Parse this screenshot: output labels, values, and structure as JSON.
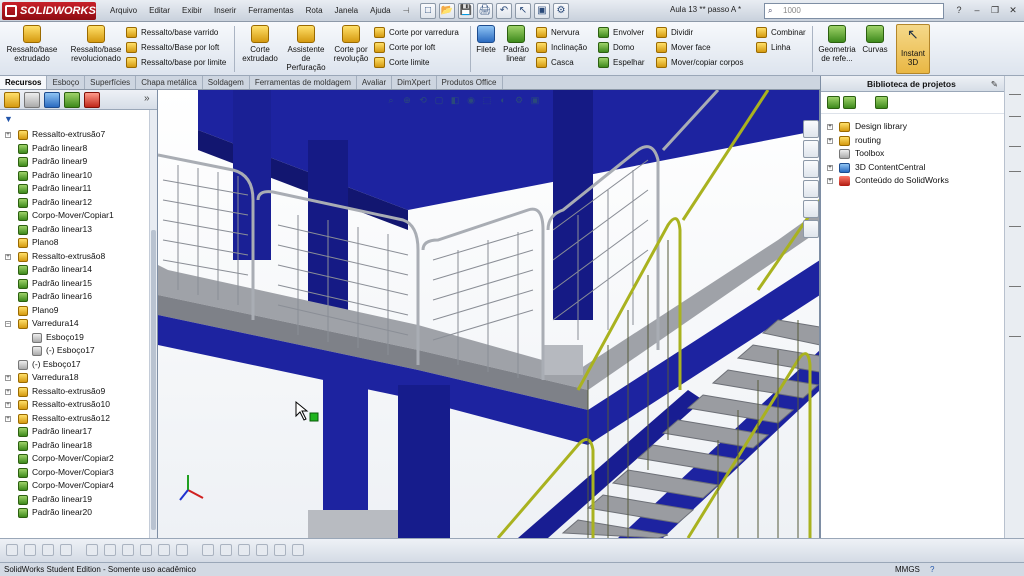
{
  "app": {
    "brand": "SOLIDWORKS",
    "document_title": "Aula 13 ** passo A *",
    "search_placeholder": "1000",
    "window_controls": [
      "?",
      "–",
      "❐",
      "✕"
    ]
  },
  "menu": [
    "Arquivo",
    "Editar",
    "Exibir",
    "Inserir",
    "Ferramentas",
    "Rota",
    "Janela",
    "Ajuda",
    "⊣"
  ],
  "quick_access": [
    "□",
    "📂",
    "💾",
    "🖨",
    "↶",
    "↖",
    "▣",
    "⚙"
  ],
  "ribbon": {
    "big": [
      {
        "label": "Ressalto/base extrudado",
        "color": "y"
      },
      {
        "label": "Ressalto/base revolucionado",
        "color": "y"
      },
      {
        "label": "Corte extrudado",
        "color": "y"
      },
      {
        "label": "Assistente de Perfuração",
        "color": "y"
      },
      {
        "label": "Corte por revolução",
        "color": "y"
      },
      {
        "label": "Filete",
        "color": "b"
      },
      {
        "label": "Padrão linear",
        "color": "g"
      },
      {
        "label": "Geometria de refe...",
        "color": "g"
      },
      {
        "label": "Curvas",
        "color": "g"
      }
    ],
    "small_col1": [
      "Ressalto/base varrido",
      "Ressalto/Base por loft",
      "Ressalto/base por limite"
    ],
    "small_col2": [
      "Corte por varredura",
      "Corte por loft",
      "Corte limite"
    ],
    "small_col3": [
      "Nervura",
      "Inclinação",
      "Casca"
    ],
    "small_col4": [
      "Envolver",
      "Domo",
      "Espelhar"
    ],
    "small_col5": [
      "Dividir",
      "Mover face",
      "Mover/copiar corpos"
    ],
    "small_col6": [
      "Combinar",
      "Linha"
    ],
    "instant3d": "Instant 3D"
  },
  "command_tabs": [
    "Recursos",
    "Esboço",
    "Superfícies",
    "Chapa metálica",
    "Soldagem",
    "Ferramentas de moldagem",
    "Avaliar",
    "DimXpert",
    "Produtos Office"
  ],
  "feature_tree": [
    {
      "label": "Ressalto-extrusão7",
      "icon": "y",
      "indent": 0,
      "exp": "+"
    },
    {
      "label": "Padrão linear8",
      "icon": "g",
      "indent": 0,
      "exp": ""
    },
    {
      "label": "Padrão linear9",
      "icon": "g",
      "indent": 0,
      "exp": ""
    },
    {
      "label": "Padrão linear10",
      "icon": "g",
      "indent": 0,
      "exp": ""
    },
    {
      "label": "Padrão linear11",
      "icon": "g",
      "indent": 0,
      "exp": ""
    },
    {
      "label": "Padrão linear12",
      "icon": "g",
      "indent": 0,
      "exp": ""
    },
    {
      "label": "Corpo-Mover/Copiar1",
      "icon": "g",
      "indent": 0,
      "exp": ""
    },
    {
      "label": "Padrão linear13",
      "icon": "g",
      "indent": 0,
      "exp": ""
    },
    {
      "label": "Plano8",
      "icon": "y",
      "indent": 0,
      "exp": ""
    },
    {
      "label": "Ressalto-extrusão8",
      "icon": "y",
      "indent": 0,
      "exp": "+"
    },
    {
      "label": "Padrão linear14",
      "icon": "g",
      "indent": 0,
      "exp": ""
    },
    {
      "label": "Padrão linear15",
      "icon": "g",
      "indent": 0,
      "exp": ""
    },
    {
      "label": "Padrão linear16",
      "icon": "g",
      "indent": 0,
      "exp": ""
    },
    {
      "label": "Plano9",
      "icon": "y",
      "indent": 0,
      "exp": ""
    },
    {
      "label": "Varredura14",
      "icon": "y",
      "indent": 0,
      "exp": "–"
    },
    {
      "label": "Esboço19",
      "icon": "gr",
      "indent": 1,
      "exp": ""
    },
    {
      "label": "(-) Esboço17",
      "icon": "gr",
      "indent": 1,
      "exp": ""
    },
    {
      "label": "(-) Esboço17",
      "icon": "gr",
      "indent": 0,
      "exp": ""
    },
    {
      "label": "Varredura18",
      "icon": "y",
      "indent": 0,
      "exp": "+"
    },
    {
      "label": "Ressalto-extrusão9",
      "icon": "y",
      "indent": 0,
      "exp": "+"
    },
    {
      "label": "Ressalto-extrusão10",
      "icon": "y",
      "indent": 0,
      "exp": "+"
    },
    {
      "label": "Ressalto-extrusão12",
      "icon": "y",
      "indent": 0,
      "exp": "+"
    },
    {
      "label": "Padrão linear17",
      "icon": "g",
      "indent": 0,
      "exp": ""
    },
    {
      "label": "Padrão linear18",
      "icon": "g",
      "indent": 0,
      "exp": ""
    },
    {
      "label": "Corpo-Mover/Copiar2",
      "icon": "g",
      "indent": 0,
      "exp": ""
    },
    {
      "label": "Corpo-Mover/Copiar3",
      "icon": "g",
      "indent": 0,
      "exp": ""
    },
    {
      "label": "Corpo-Mover/Copiar4",
      "icon": "g",
      "indent": 0,
      "exp": ""
    },
    {
      "label": "Padrão linear19",
      "icon": "g",
      "indent": 0,
      "exp": ""
    },
    {
      "label": "Padrão linear20",
      "icon": "g",
      "indent": 0,
      "exp": ""
    }
  ],
  "design_library": {
    "title": "Biblioteca de projetos",
    "items": [
      {
        "label": "Design library",
        "icon": "y",
        "exp": "+"
      },
      {
        "label": "routing",
        "icon": "y",
        "exp": "+"
      },
      {
        "label": "Toolbox",
        "icon": "gr",
        "exp": ""
      },
      {
        "label": "3D ContentCentral",
        "icon": "b",
        "exp": "+"
      },
      {
        "label": "Conteúdo do SolidWorks",
        "icon": "r",
        "exp": "+"
      }
    ]
  },
  "status": {
    "text": "SolidWorks Student Edition - Somente uso acadêmico",
    "units": "MMGS",
    "help": "?"
  },
  "colors": {
    "structure_blue": "#1d23a0",
    "structure_dark": "#121670",
    "railing_gray": "#a9adb4",
    "railing_yellow": "#a9b21f",
    "step_gray": "#9a9ca1"
  }
}
